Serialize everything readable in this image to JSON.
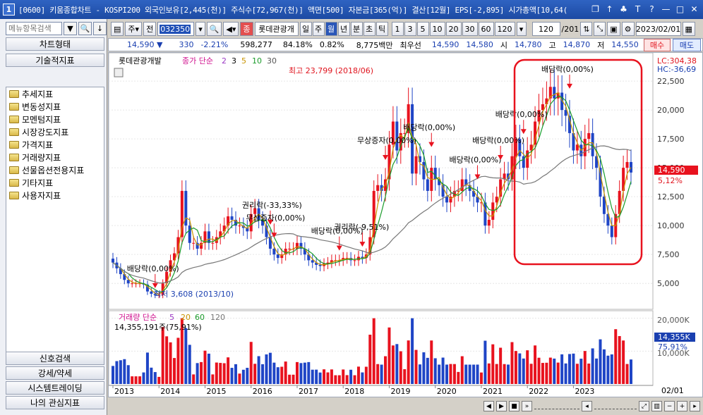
{
  "title": {
    "num": "1",
    "text": "[0600] 키움종합차트 - KOSPI200 외국인보유[2,445(천)] 주식수[72,967(천)] 액면[500] 자본금[365(억)] 결산[12월] EPS[-2,895] 시가총액[10,64("
  },
  "left": {
    "search_placeholder": "메뉴항목검색",
    "chart_type": "차트형태",
    "tech_indicators": "기술적지표",
    "folders": [
      "추세지표",
      "변동성지표",
      "모멘텀지표",
      "시장강도지표",
      "가격지표",
      "거래량지표",
      "선물옵션전용지표",
      "기타지표",
      "사용자지표"
    ],
    "bottom": [
      "신호검색",
      "강세/약세",
      "시스템트레이딩",
      "나의 관심지표"
    ]
  },
  "toolbar": {
    "market": "주",
    "prev": "전",
    "code": "032350",
    "name_badge": "종",
    "name": "롯데관광개",
    "periods": [
      "일",
      "주",
      "월",
      "년",
      "분",
      "초",
      "틱"
    ],
    "selected_period": "월",
    "intervals": [
      "1",
      "3",
      "5",
      "10",
      "20",
      "30",
      "60",
      "120"
    ],
    "count": "120",
    "total": "/201",
    "date": "2023/02/01"
  },
  "info": {
    "price": "14,590 ▼",
    "change": "330",
    "change_pct": "-2.21%",
    "volume": "598,277",
    "pct1": "84.18%",
    "pct2": "0.82%",
    "amount": "8,775백만",
    "best": "최우선",
    "ask": "14,590",
    "bid": "14,580",
    "open_label": "시",
    "open": "14,780",
    "high_label": "고",
    "high": "14,870",
    "low_label": "저",
    "low": "14,550",
    "buy": "매수",
    "sell": "매도"
  },
  "chart_legend": {
    "name": "롯데관광개발",
    "close_label": "종가 단순",
    "ma": [
      "2",
      "3",
      "5",
      "10",
      "30"
    ],
    "vol_label": "거래량 단순",
    "vol_ma": [
      "5",
      "20",
      "60",
      "120"
    ],
    "vol_value": "14,355,191주(75,91%)"
  },
  "annotations": {
    "lc": "LC:304,38",
    "hc": "HC:-36,69",
    "high_note": "최고 23,799 (2018/06)",
    "low_note": "최저 3,608 (2013/10)",
    "price_tag": "14,590",
    "pct_tag": "5,12%",
    "vol_tag": "14,355K",
    "vol_pct_tag": "75,91%",
    "vol_axis_top": "20,000K",
    "vol_axis_mid": "10,000K",
    "date_tag": "02/01",
    "events": [
      {
        "label": "배당락(0,00%)",
        "date": "2013/12"
      },
      {
        "label": "권리락(-33,33%)",
        "date": "2016/06"
      },
      {
        "label": "무상증자(0,00%)",
        "date": "2016/07"
      },
      {
        "label": "배당락(0,00%)",
        "date": "2017/12"
      },
      {
        "label": "권리락(-9,51%)",
        "date": "2018/06"
      },
      {
        "label": "무상증자(0,00%)",
        "date": "2018/12"
      },
      {
        "label": "배당락(0,00%)",
        "date": "2019/12"
      },
      {
        "label": "배당락(0,00%)",
        "date": "2020/12"
      },
      {
        "label": "배당락(0,00%)",
        "date": "2021/06"
      },
      {
        "label": "배당락(0,00%)",
        "date": "2021/12"
      },
      {
        "label": "배당락(0,00%)",
        "date": "2022/12"
      }
    ]
  },
  "chart_data": {
    "type": "candlestick",
    "x_ticks": [
      "2013",
      "2014",
      "2015",
      "2016",
      "2017",
      "2018",
      "2019",
      "2020",
      "2021",
      "2022",
      "2023"
    ],
    "y_ticks": [
      5000,
      7500,
      10000,
      12500,
      15000,
      17500,
      20000,
      22500
    ],
    "y_tick_labels": [
      "5,000",
      "7,500",
      "10,000",
      "12,500",
      "15,000",
      "17,500",
      "20,000",
      "22,500"
    ],
    "ylim": [
      3000,
      24700
    ],
    "vol_ylim": [
      0,
      21000
    ],
    "start": "2013/01",
    "close": [
      6800,
      6300,
      5800,
      5300,
      5000,
      5000,
      5000,
      5000,
      4900,
      4300,
      4100,
      4000,
      4000,
      5000,
      6000,
      7000,
      7600,
      9000,
      13000,
      10000,
      8500,
      8500,
      8000,
      8500,
      9500,
      8500,
      8500,
      9000,
      9500,
      10000,
      10800,
      10500,
      10000,
      10000,
      9800,
      9500,
      11000,
      11500,
      10500,
      10000,
      9000,
      8000,
      7500,
      7200,
      7500,
      8000,
      8000,
      8000,
      8500,
      8000,
      7500,
      7000,
      6800,
      6600,
      6500,
      6700,
      6800,
      7000,
      7000,
      7000,
      7200,
      7200,
      7000,
      7000,
      7300,
      7200,
      7500,
      9000,
      13000,
      13500,
      13000,
      14000,
      17000,
      19000,
      16500,
      18000,
      18000,
      20500,
      14500,
      16000,
      15500,
      14000,
      13000,
      15000,
      14000,
      13500,
      12500,
      12000,
      12500,
      13000,
      13000,
      14000,
      13500,
      13000,
      12500,
      12000,
      12000,
      10000,
      10500,
      12000,
      12500,
      14000,
      14500,
      14000,
      16000,
      17500,
      16000,
      15000,
      16500,
      17000,
      19000,
      20000,
      20500,
      21000,
      22000,
      21000,
      21500,
      20000,
      19500,
      18000,
      16500,
      17000,
      16000,
      17500,
      18000,
      16000,
      15000,
      12500,
      11000,
      10000,
      9000,
      11000,
      13000,
      15000,
      15500,
      14590
    ],
    "vol_every_month": true
  }
}
